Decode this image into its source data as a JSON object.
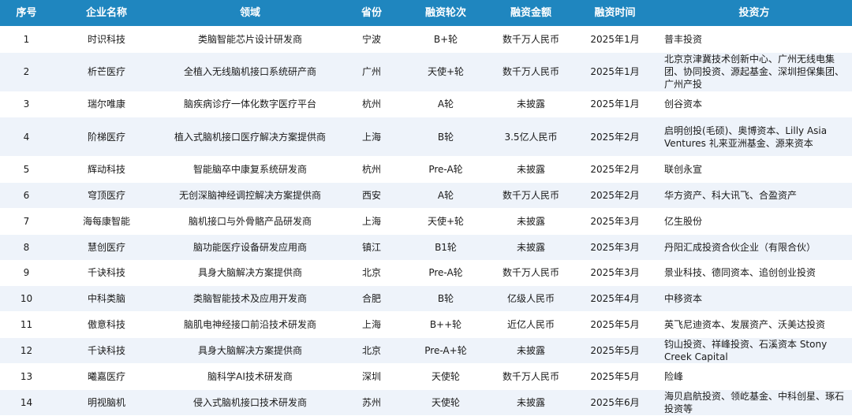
{
  "headers": [
    "序号",
    "企业名称",
    "领域",
    "省份",
    "融资轮次",
    "融资金额",
    "融资时间",
    "投资方"
  ],
  "rows": [
    {
      "index": "1",
      "company": "时识科技",
      "field": "类脑智能芯片设计研发商",
      "province": "宁波",
      "round": "B+轮",
      "amount": "数千万人民币",
      "date": "2025年1月",
      "investors": "普丰投资"
    },
    {
      "index": "2",
      "company": "析芒医疗",
      "field": "全植入无线脑机接口系统研产商",
      "province": "广州",
      "round": "天使+轮",
      "amount": "数千万人民币",
      "date": "2025年1月",
      "investors": "北京京津冀技术创新中心、广州无线电集团、协同投资、源起基金、深圳担保集团、广州产投"
    },
    {
      "index": "3",
      "company": "瑞尔唯康",
      "field": "脑疾病诊疗一体化数字医疗平台",
      "province": "杭州",
      "round": "A轮",
      "amount": "未披露",
      "date": "2025年1月",
      "investors": "创谷资本"
    },
    {
      "index": "4",
      "company": "阶梯医疗",
      "field": "植入式脑机接口医疗解决方案提供商",
      "province": "上海",
      "round": "B轮",
      "amount": "3.5亿人民币",
      "date": "2025年2月",
      "investors": "启明创投(毛硕)、奥博资本、Lilly Asia Ventures 礼来亚洲基金、源来资本"
    },
    {
      "index": "5",
      "company": "辉动科技",
      "field": "智能脑卒中康复系统研发商",
      "province": "杭州",
      "round": "Pre-A轮",
      "amount": "未披露",
      "date": "2025年2月",
      "investors": "联创永宣"
    },
    {
      "index": "6",
      "company": "穹顶医疗",
      "field": "无创深脑神经调控解决方案提供商",
      "province": "西安",
      "round": "A轮",
      "amount": "数千万人民币",
      "date": "2025年2月",
      "investors": "华方资产、科大讯飞、合盈资产"
    },
    {
      "index": "7",
      "company": "海每康智能",
      "field": "脑机接口与外骨骼产品研发商",
      "province": "上海",
      "round": "天使+轮",
      "amount": "未披露",
      "date": "2025年3月",
      "investors": "亿生股份"
    },
    {
      "index": "8",
      "company": "慧创医疗",
      "field": "脑功能医疗设备研发应用商",
      "province": "镇江",
      "round": "B1轮",
      "amount": "未披露",
      "date": "2025年3月",
      "investors": "丹阳汇成投资合伙企业（有限合伙）"
    },
    {
      "index": "9",
      "company": "千诀科技",
      "field": "具身大脑解决方案提供商",
      "province": "北京",
      "round": "Pre-A轮",
      "amount": "数千万人民币",
      "date": "2025年3月",
      "investors": "景业科技、德同资本、追创创业投资"
    },
    {
      "index": "10",
      "company": "中科类脑",
      "field": "类脑智能技术及应用开发商",
      "province": "合肥",
      "round": "B轮",
      "amount": "亿级人民币",
      "date": "2025年4月",
      "investors": "中移资本"
    },
    {
      "index": "11",
      "company": "傲意科技",
      "field": "脑肌电神经接口前沿技术研发商",
      "province": "上海",
      "round": "B++轮",
      "amount": "近亿人民币",
      "date": "2025年5月",
      "investors": "英飞尼迪资本、发展资产、沃美达投资"
    },
    {
      "index": "12",
      "company": "千诀科技",
      "field": "具身大脑解决方案提供商",
      "province": "北京",
      "round": "Pre-A+轮",
      "amount": "未披露",
      "date": "2025年5月",
      "investors": "钧山投资、祥峰投资、石溪资本 Stony Creek Capital"
    },
    {
      "index": "13",
      "company": "曦嘉医疗",
      "field": "脑科学AI技术研发商",
      "province": "深圳",
      "round": "天使轮",
      "amount": "数千万人民币",
      "date": "2025年5月",
      "investors": "险峰"
    },
    {
      "index": "14",
      "company": "明视脑机",
      "field": "侵入式脑机接口技术研发商",
      "province": "苏州",
      "round": "天使轮",
      "amount": "未披露",
      "date": "2025年6月",
      "investors": "海贝启航投资、领屹基金、中科创星、琢石投资等"
    }
  ]
}
